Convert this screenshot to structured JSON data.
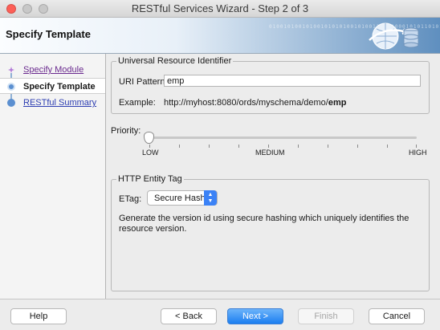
{
  "window": {
    "title": "RESTful Services Wizard - Step 2 of 3"
  },
  "header": {
    "title": "Specify Template",
    "binary_text": "0100101001010010101010010100110101000101011010101001010101000101010101010100110101001010"
  },
  "steps": [
    {
      "label": "Specify Module",
      "state": "visited"
    },
    {
      "label": "Specify Template",
      "state": "current"
    },
    {
      "label": "RESTful Summary",
      "state": "pending"
    }
  ],
  "uri_section": {
    "legend": "Universal Resource Identifier",
    "pattern_label": "URI Pattern:",
    "pattern_value": "emp",
    "example_label": "Example:",
    "example_prefix": "http://myhost:8080/ords/myschema/demo/",
    "example_suffix": "emp"
  },
  "priority": {
    "label": "Priority:",
    "low": "LOW",
    "medium": "MEDIUM",
    "high": "HIGH",
    "value": 0
  },
  "etag_section": {
    "legend": "HTTP Entity Tag",
    "label": "ETag:",
    "selected": "Secure Hash",
    "description": "Generate the version id using secure hashing which uniquely identifies the resource version."
  },
  "buttons": {
    "help": "Help",
    "back": "< Back",
    "next": "Next >",
    "finish": "Finish",
    "cancel": "Cancel"
  },
  "colors": {
    "primary_button": "#1b7ef0",
    "link": "#2c3db1",
    "visited_link": "#6a2a8e",
    "step_icon": "#5b8fd0"
  }
}
